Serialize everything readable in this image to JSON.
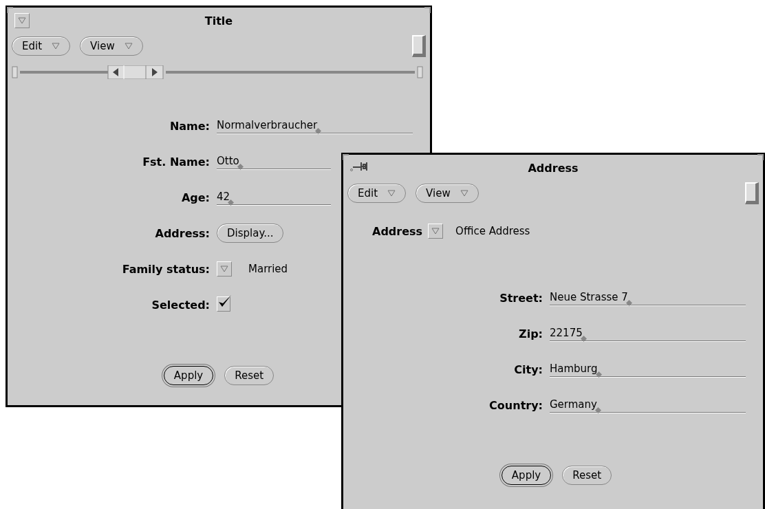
{
  "windows": [
    {
      "kind": "base",
      "title": "Title",
      "menus": [
        {
          "label": "Edit"
        },
        {
          "label": "View"
        }
      ],
      "scrollbar": true,
      "fields": [
        {
          "kind": "text",
          "label": "Name:",
          "value": "Normalverbraucher"
        },
        {
          "kind": "text",
          "label": "Fst. Name:",
          "value": "Otto"
        },
        {
          "kind": "text",
          "label": "Age:",
          "value": "42"
        },
        {
          "kind": "button",
          "label": "Address:",
          "value": "Display..."
        },
        {
          "kind": "choice",
          "label": "Family status:",
          "value": "Married"
        },
        {
          "kind": "checkbox",
          "label": "Selected:",
          "checked": true
        }
      ],
      "buttons": [
        {
          "label": "Apply",
          "default": true
        },
        {
          "label": "Reset",
          "default": false
        }
      ]
    },
    {
      "kind": "popup",
      "title": "Address",
      "menus": [
        {
          "label": "Edit"
        },
        {
          "label": "View"
        }
      ],
      "selector": {
        "label": "Address",
        "value": "Office Address"
      },
      "fields": [
        {
          "kind": "text",
          "label": "Street:",
          "value": "Neue Strasse 7"
        },
        {
          "kind": "text",
          "label": "Zip:",
          "value": "22175"
        },
        {
          "kind": "text",
          "label": "City:",
          "value": "Hamburg"
        },
        {
          "kind": "text",
          "label": "Country:",
          "value": "Germany"
        }
      ],
      "buttons": [
        {
          "label": "Apply",
          "default": true
        },
        {
          "label": "Reset",
          "default": false
        }
      ]
    }
  ]
}
